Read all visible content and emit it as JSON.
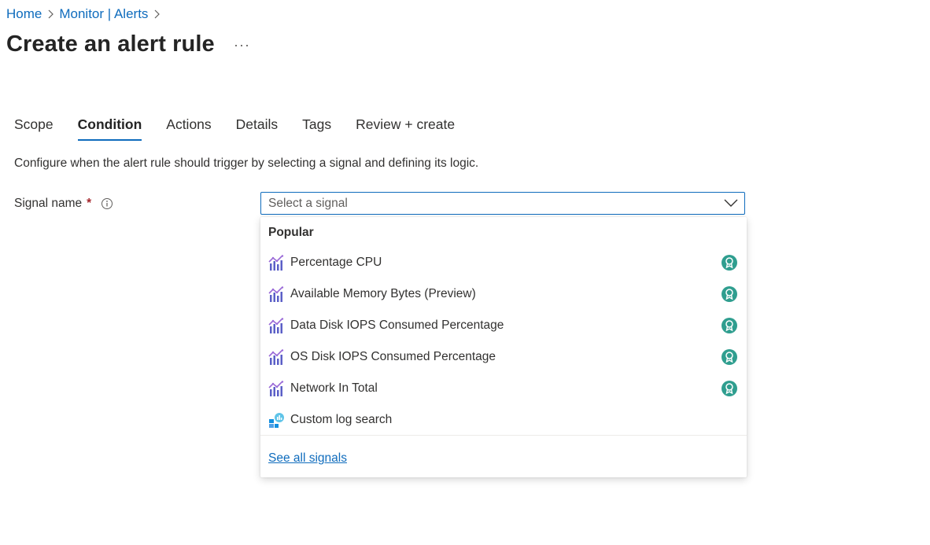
{
  "breadcrumb": {
    "items": [
      {
        "label": "Home"
      },
      {
        "label": "Monitor | Alerts"
      }
    ]
  },
  "page": {
    "title": "Create an alert rule",
    "more_label": "···"
  },
  "tabs": [
    {
      "label": "Scope"
    },
    {
      "label": "Condition",
      "active": true
    },
    {
      "label": "Actions"
    },
    {
      "label": "Details"
    },
    {
      "label": "Tags"
    },
    {
      "label": "Review + create"
    }
  ],
  "description": "Configure when the alert rule should trigger by selecting a signal and defining its logic.",
  "signal_field": {
    "label": "Signal name",
    "required_mark": "*",
    "placeholder": "Select a signal"
  },
  "dropdown": {
    "group_header": "Popular",
    "items": [
      {
        "label": "Percentage CPU",
        "icon": "metric-chart-icon",
        "recommended": true
      },
      {
        "label": "Available Memory Bytes (Preview)",
        "icon": "metric-chart-icon",
        "recommended": true
      },
      {
        "label": "Data Disk IOPS Consumed Percentage",
        "icon": "metric-chart-icon",
        "recommended": true
      },
      {
        "label": "OS Disk IOPS Consumed Percentage",
        "icon": "metric-chart-icon",
        "recommended": true
      },
      {
        "label": "Network In Total",
        "icon": "metric-chart-icon",
        "recommended": true
      },
      {
        "label": "Custom log search",
        "icon": "log-search-icon",
        "recommended": false
      }
    ],
    "see_all_label": "See all signals"
  },
  "colors": {
    "accent": "#0f6cbd",
    "required": "#a4262c",
    "badge": "#2f9e8f"
  }
}
